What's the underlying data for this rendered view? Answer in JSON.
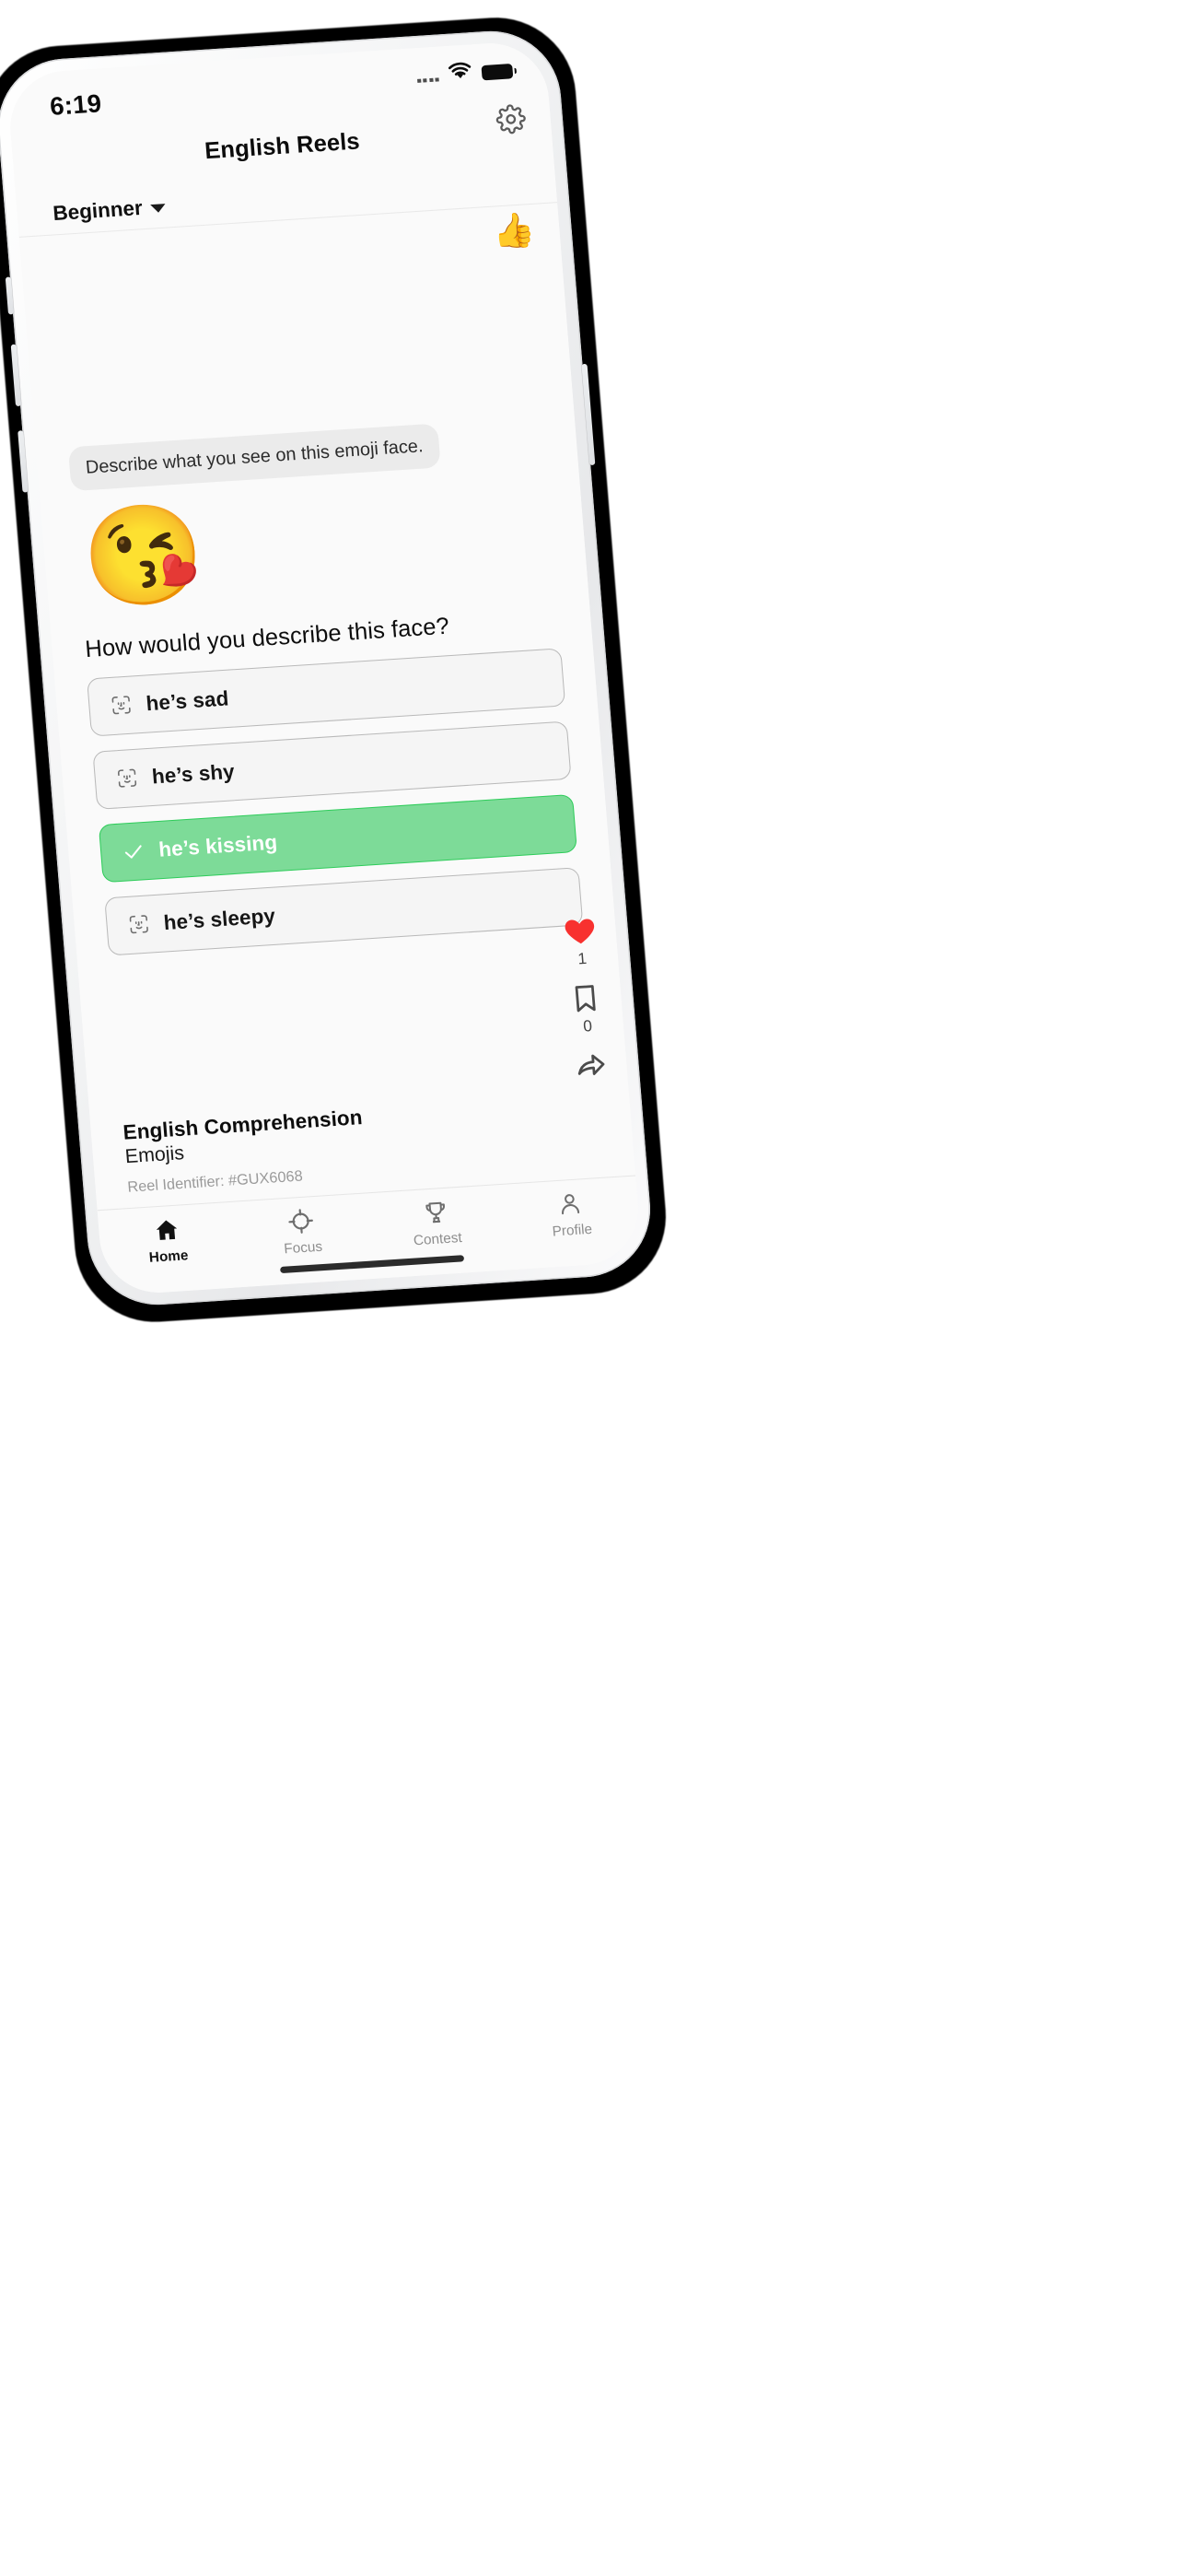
{
  "status_bar": {
    "time": "6:19",
    "wifi_icon": "wifi-icon",
    "battery_icon": "battery-icon",
    "signal_icon": "signal-dots-icon"
  },
  "header": {
    "title": "English Reels",
    "settings_icon": "gear-icon"
  },
  "level_selector": {
    "label": "Beginner",
    "chevron_icon": "chevron-down-icon"
  },
  "feedback": {
    "thumbs_up_icon": "thumbs-up-icon",
    "thumbs_up_glyph": "👍"
  },
  "reel": {
    "prompt": "Describe what you see on this emoji face.",
    "emoji": "😘",
    "emoji_name": "face-blowing-a-kiss",
    "question": "How would you describe this face?",
    "options": [
      {
        "label": "he’s sad",
        "icon": "face-id-icon",
        "selected": false
      },
      {
        "label": "he’s shy",
        "icon": "face-id-icon",
        "selected": false
      },
      {
        "label": "he’s kissing",
        "icon": "check-icon",
        "selected": true
      },
      {
        "label": "he’s sleepy",
        "icon": "face-id-icon",
        "selected": false
      }
    ]
  },
  "actions": {
    "like": {
      "icon": "heart-icon",
      "count": "1"
    },
    "bookmark": {
      "icon": "bookmark-icon",
      "count": "0"
    },
    "share": {
      "icon": "share-arrow-icon"
    }
  },
  "meta": {
    "title": "English Comprehension",
    "subtitle": "Emojis",
    "identifier": "Reel Identifier: #GUX6068"
  },
  "tabbar": {
    "items": [
      {
        "label": "Home",
        "icon": "home-icon",
        "active": true
      },
      {
        "label": "Focus",
        "icon": "target-icon",
        "active": false
      },
      {
        "label": "Contest",
        "icon": "trophy-icon",
        "active": false
      },
      {
        "label": "Profile",
        "icon": "person-icon",
        "active": false
      }
    ]
  },
  "colors": {
    "selected_fill": "#7ddb98",
    "selected_border": "#2ecc5a",
    "heart": "#f8312f",
    "screen_bg": "#fafafa"
  }
}
